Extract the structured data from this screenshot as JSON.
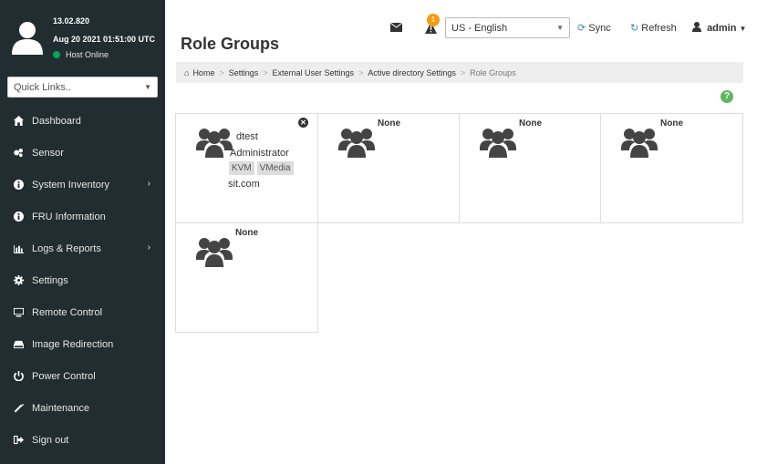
{
  "sidebar": {
    "fw_version": "13.02.820",
    "datetime": "Aug 20 2021 01:51:00 UTC",
    "host_status": "Host Online",
    "quick_links_placeholder": "Quick Links..",
    "items": [
      {
        "label": "Dashboard",
        "icon": "dashboard-icon"
      },
      {
        "label": "Sensor",
        "icon": "sensor-icon"
      },
      {
        "label": "System Inventory",
        "icon": "info-icon",
        "has_children": true
      },
      {
        "label": "FRU Information",
        "icon": "info-icon"
      },
      {
        "label": "Logs & Reports",
        "icon": "chart-icon",
        "has_children": true
      },
      {
        "label": "Settings",
        "icon": "gear-icon"
      },
      {
        "label": "Remote Control",
        "icon": "monitor-icon"
      },
      {
        "label": "Image Redirection",
        "icon": "drive-icon"
      },
      {
        "label": "Power Control",
        "icon": "power-icon"
      },
      {
        "label": "Maintenance",
        "icon": "wrench-icon"
      },
      {
        "label": "Sign out",
        "icon": "sign-out-icon"
      }
    ]
  },
  "header": {
    "title": "Role Groups",
    "alert_count": "1",
    "language": "US - English",
    "sync_label": "Sync",
    "refresh_label": "Refresh",
    "user": "admin"
  },
  "breadcrumb": [
    "Home",
    "Settings",
    "External User Settings",
    "Active directory Settings",
    "Role Groups"
  ],
  "role_groups": [
    {
      "name": "dtest",
      "privilege": "Administrator",
      "permissions": [
        "KVM",
        "VMedia"
      ],
      "domain": "sit.com"
    },
    {
      "name": "None"
    },
    {
      "name": "None"
    },
    {
      "name": "None"
    },
    {
      "name": "None"
    }
  ],
  "colors": {
    "sidebar_bg": "#222d32",
    "accent": "#3c8dbc",
    "online": "#00a65a",
    "badge": "#f39c12",
    "help": "#5cb85c"
  }
}
